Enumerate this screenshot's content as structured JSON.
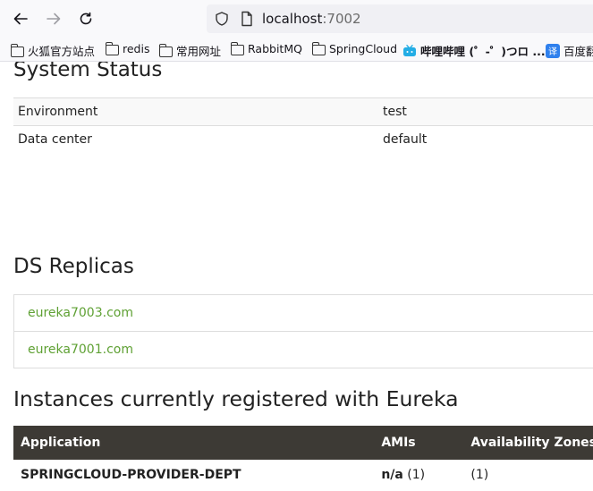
{
  "browser": {
    "url_host": "localhost",
    "url_port": ":7002",
    "bookmarks": [
      {
        "label": "火狐官方站点",
        "icon": "folder-icon"
      },
      {
        "label": "redis",
        "icon": "folder-icon"
      },
      {
        "label": "常用网址",
        "icon": "folder-icon"
      },
      {
        "label": "RabbitMQ",
        "icon": "folder-icon"
      },
      {
        "label": "SpringCloud",
        "icon": "folder-icon"
      },
      {
        "label": "哔哩哔哩 (゜-゜)つロ ...",
        "icon": "bilibili-icon"
      },
      {
        "label": "百度翻",
        "icon": "translate-icon"
      }
    ]
  },
  "system_status": {
    "title": "System Status",
    "rows": [
      {
        "label": "Environment",
        "value": "test"
      },
      {
        "label": "Data center",
        "value": "default"
      }
    ]
  },
  "ds_replicas": {
    "title": "DS Replicas",
    "items": [
      "eureka7003.com",
      "eureka7001.com"
    ]
  },
  "instances": {
    "title": "Instances currently registered with Eureka",
    "headers": [
      "Application",
      "AMIs",
      "Availability Zones"
    ],
    "rows": [
      {
        "application": "SPRINGCLOUD-PROVIDER-DEPT",
        "amis_bold": "n/a",
        "amis_count": " (1)",
        "zones": "(1)"
      }
    ]
  },
  "colors": {
    "link": "#5fa134",
    "table_header": "#3d3a35"
  }
}
